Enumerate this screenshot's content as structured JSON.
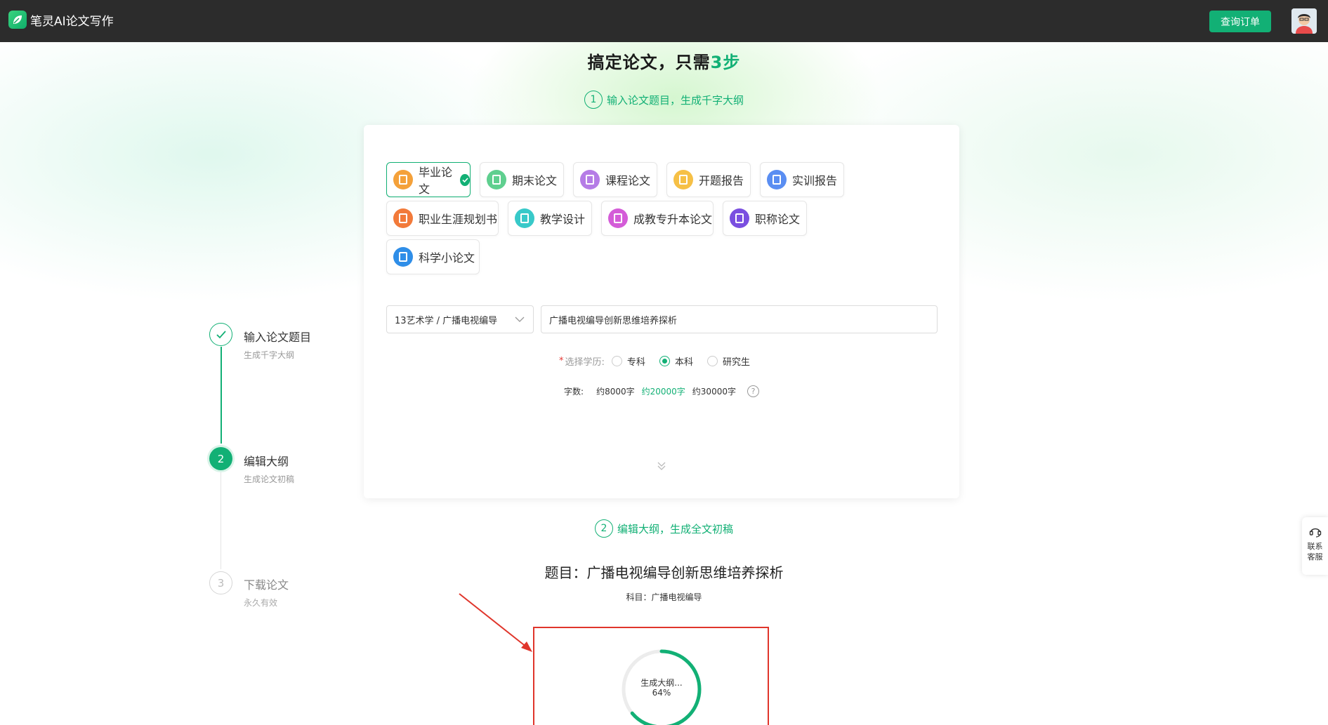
{
  "header": {
    "app_name": "笔灵AI论文写作",
    "order_button": "查询订单"
  },
  "hero": {
    "title_prefix": "搞定论文，只需",
    "title_accent": "3步"
  },
  "section1": {
    "num": "1",
    "label": "输入论文题目，生成千字大纲"
  },
  "section2": {
    "num": "2",
    "label": "编辑大纲，生成全文初稿"
  },
  "paper_types": [
    {
      "label": "毕业论文",
      "color": "#f4a13a",
      "selected": true
    },
    {
      "label": "期末论文",
      "color": "#5fcf8f",
      "selected": false
    },
    {
      "label": "课程论文",
      "color": "#b57ce6",
      "selected": false
    },
    {
      "label": "开题报告",
      "color": "#f6c046",
      "selected": false
    },
    {
      "label": "实训报告",
      "color": "#5a8ef2",
      "selected": false
    },
    {
      "label": "职业生涯规划书",
      "color": "#f27a3a",
      "selected": false
    },
    {
      "label": "教学设计",
      "color": "#38c9c9",
      "selected": false
    },
    {
      "label": "成教专升本论文",
      "color": "#d45cd8",
      "selected": false
    },
    {
      "label": "职称论文",
      "color": "#7a4fe0",
      "selected": false
    },
    {
      "label": "科学小论文",
      "color": "#2f8ee8",
      "selected": false
    }
  ],
  "form": {
    "subject": "13艺术学 / 广播电视编导",
    "title_value": "广播电视编导创新思维培养探析",
    "education_label": "选择学历:",
    "education_options": [
      "专科",
      "本科",
      "研究生"
    ],
    "education_selected": "本科",
    "words_label": "字数:",
    "word_options": [
      "约8000字",
      "约20000字",
      "约30000字"
    ],
    "word_selected": "约20000字"
  },
  "steps": [
    {
      "num": "1",
      "title": "输入论文题目",
      "sub": "生成千字大纲",
      "state": "done"
    },
    {
      "num": "2",
      "title": "编辑大纲",
      "sub": "生成论文初稿",
      "state": "active"
    },
    {
      "num": "3",
      "title": "下载论文",
      "sub": "永久有效",
      "state": "pending"
    }
  ],
  "outline": {
    "title": "题目：广播电视编导创新思维培养探析",
    "subject": "科目：广播电视编导",
    "progress_label": "生成大纲...",
    "progress_text": "64%",
    "progress": 0.64
  },
  "support": {
    "label": "联系客服"
  },
  "colors": {
    "brand": "#12b075",
    "annotation": "#e0352b"
  }
}
